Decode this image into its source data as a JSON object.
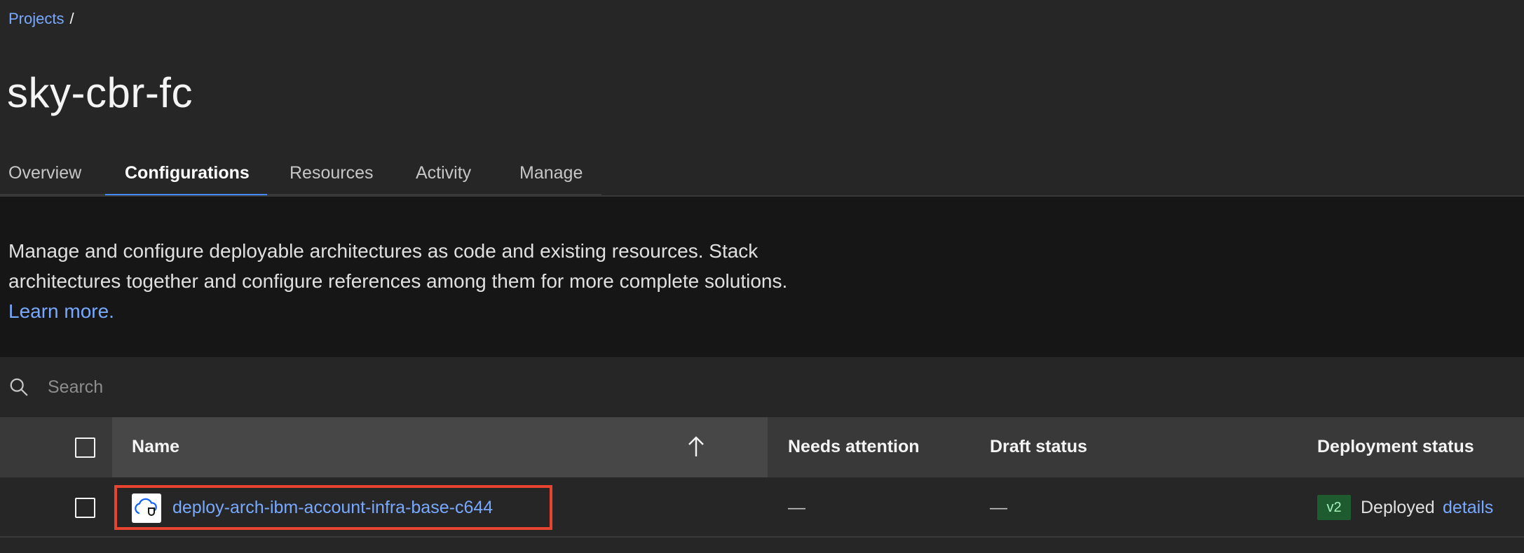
{
  "breadcrumb": {
    "projects_label": "Projects",
    "separator": "/"
  },
  "page": {
    "title": "sky-cbr-fc"
  },
  "tabs": [
    {
      "label": "Overview",
      "active": false
    },
    {
      "label": "Configurations",
      "active": true
    },
    {
      "label": "Resources",
      "active": false
    },
    {
      "label": "Activity",
      "active": false
    },
    {
      "label": "Manage",
      "active": false
    }
  ],
  "description": {
    "text": "Manage and configure deployable architectures as code and existing resources. Stack architectures together and configure references among them for more complete solutions.",
    "link_label": "Learn more."
  },
  "search": {
    "placeholder": "Search",
    "icon": "search-icon"
  },
  "table": {
    "columns": {
      "name": "Name",
      "needs_attention": "Needs attention",
      "draft_status": "Draft status",
      "deployment_status": "Deployment status"
    },
    "sort_icon": "arrow-up-icon",
    "rows": [
      {
        "name": "deploy-arch-ibm-account-infra-base-c644",
        "icon": "cloud-shield-icon",
        "needs_attention": "—",
        "draft_status": "—",
        "version": "v2",
        "deployment_status": "Deployed",
        "details_label": "details"
      }
    ]
  },
  "colors": {
    "accent": "#4589ff",
    "link": "#78a9ff",
    "highlight_box": "#e8432e",
    "version_tag_bg": "#1e5b2e"
  }
}
